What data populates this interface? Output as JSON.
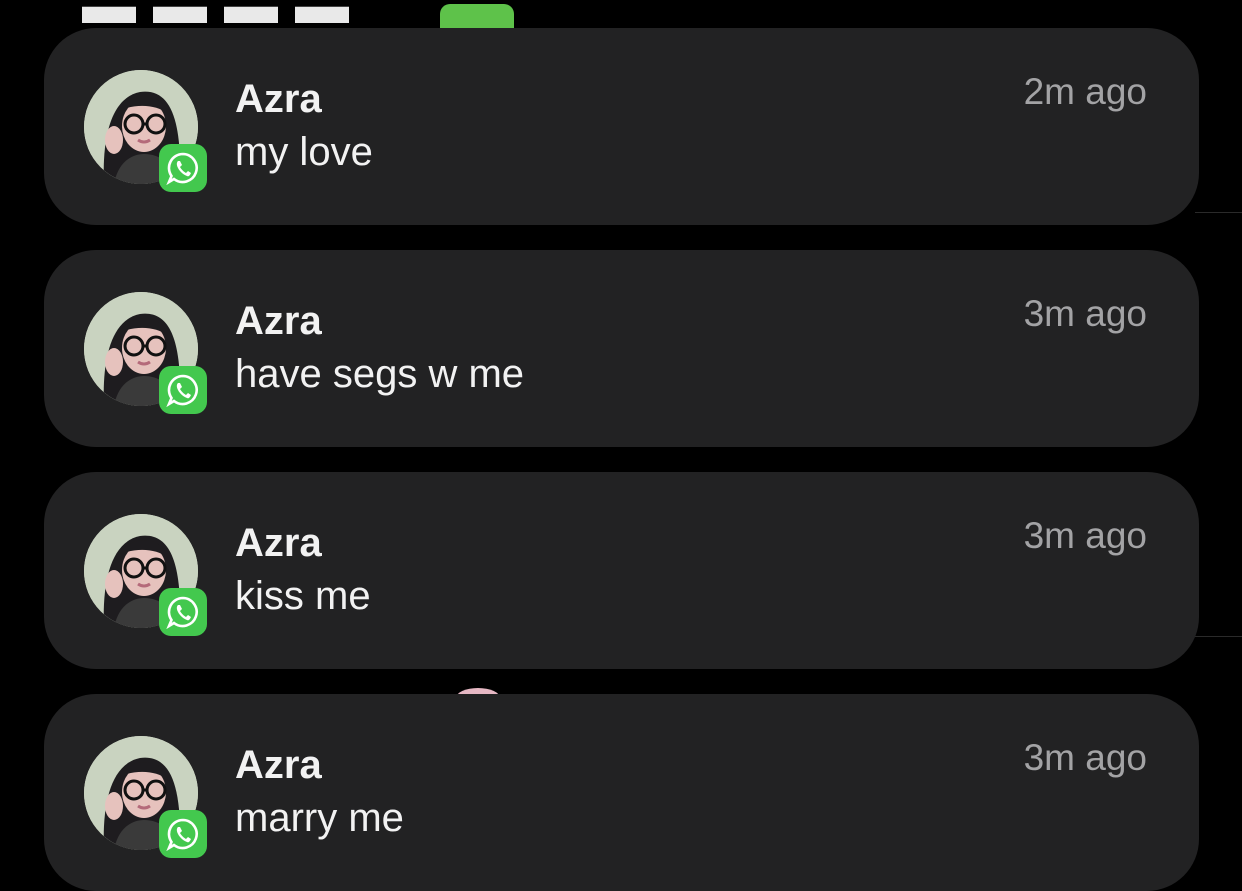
{
  "notifications": [
    {
      "sender": "Azra",
      "message": "my love",
      "time": "2m ago",
      "app_icon": "whatsapp-icon"
    },
    {
      "sender": "Azra",
      "message": "have segs w me",
      "time": "3m ago",
      "app_icon": "whatsapp-icon"
    },
    {
      "sender": "Azra",
      "message": "kiss me",
      "time": "3m ago",
      "app_icon": "whatsapp-icon"
    },
    {
      "sender": "Azra",
      "message": "marry me",
      "time": "3m ago",
      "app_icon": "whatsapp-icon"
    }
  ],
  "colors": {
    "background": "#000000",
    "card": "#222223",
    "primary_text": "#f2f2f2",
    "secondary_text": "#a3a3a5",
    "whatsapp_green": "#43c84e"
  }
}
